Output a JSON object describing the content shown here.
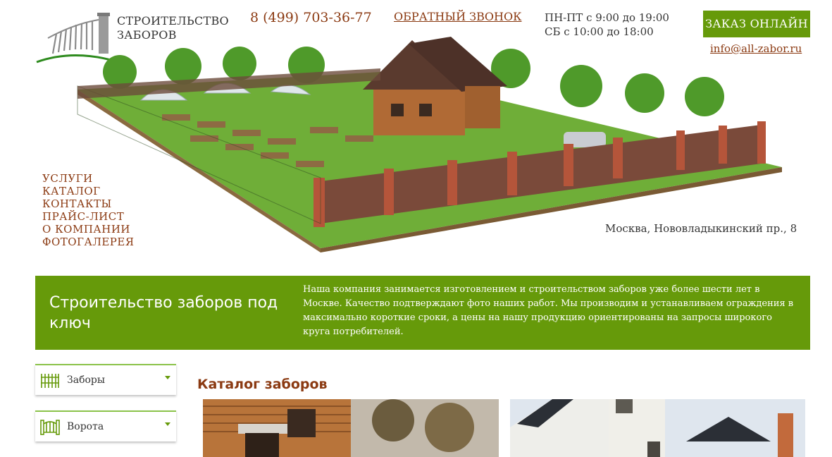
{
  "header": {
    "logo_line1": "СТРОИТЕЛЬСТВО",
    "logo_line2": "ЗАБОРОВ",
    "phone": "8 (499) 703-36-77",
    "callback": "ОБРАТНЫЙ ЗВОНОК",
    "hours_line1": "ПН-ПТ с 9:00 до 19:00",
    "hours_line2": "СБ с 10:00 до 18:00",
    "order_button": "ЗАКАЗ ОНЛАЙН",
    "email": "info@all-zabor.ru"
  },
  "menu": {
    "items": [
      {
        "label": "УСЛУГИ"
      },
      {
        "label": "КАТАЛОГ"
      },
      {
        "label": "КОНТАКТЫ"
      },
      {
        "label": "ПРАЙС-ЛИСТ"
      },
      {
        "label": "О КОМПАНИИ"
      },
      {
        "label": "ФОТОГАЛЕРЕЯ"
      }
    ]
  },
  "address": "Москва, Нововладыкинский пр., 8",
  "banner": {
    "title": "Строительство заборов под ключ",
    "text": "Наша компания занимается изготовлением и строительством заборов уже более шести лет в Москве. Качество подтверждают фото наших работ. Мы производим и устанавливаем ограждения в максимально короткие сроки, а цены на нашу продукцию ориентированы на запросы широкого круга потребителей."
  },
  "sidebar": {
    "items": [
      {
        "label": "Заборы",
        "icon": "fence-icon"
      },
      {
        "label": "Ворота",
        "icon": "gate-icon"
      }
    ]
  },
  "catalog": {
    "title": "Каталог заборов"
  },
  "colors": {
    "brand_green": "#669a0a",
    "link_brown": "#8b3a12"
  }
}
